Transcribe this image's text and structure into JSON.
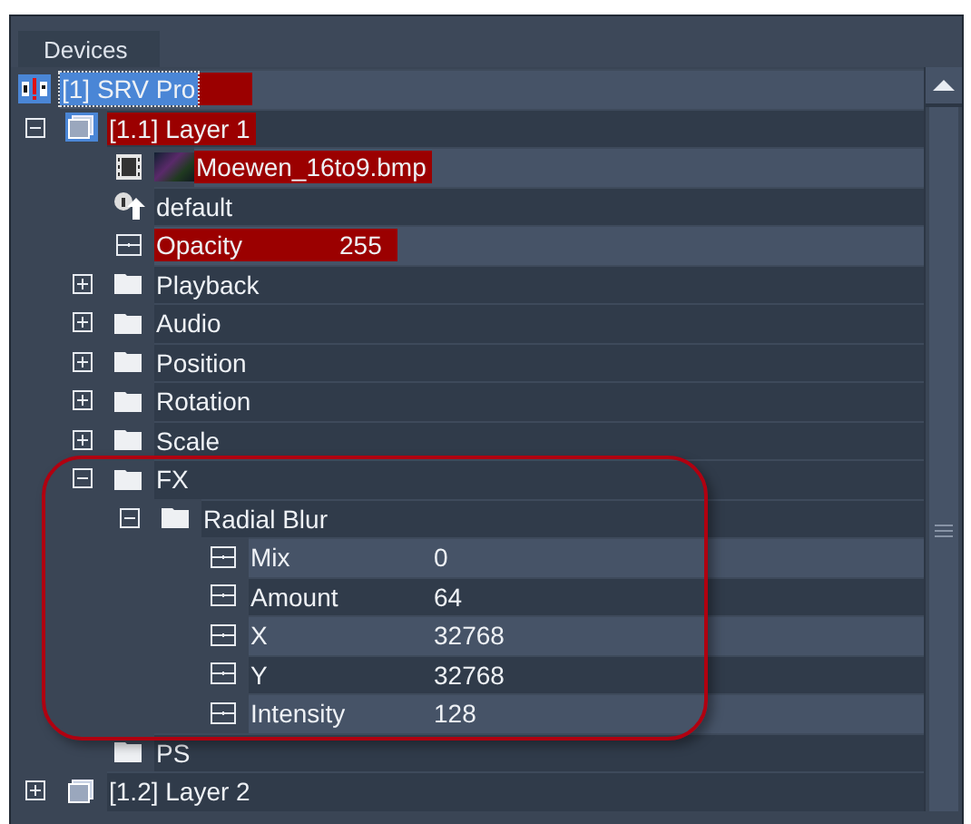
{
  "panel": {
    "title": "Devices"
  },
  "tree": [
    {
      "kind": "device",
      "label": "[1] SRV Pro",
      "selected": true,
      "highlighted": true,
      "children": [
        {
          "kind": "layer",
          "label": "[1.1] Layer 1",
          "selected": false,
          "highlighted": true,
          "expanded": true,
          "children": [
            {
              "kind": "media",
              "label": "Moewen_16to9.bmp",
              "selected": false,
              "highlighted": true
            },
            {
              "kind": "setting",
              "label": "default",
              "selected": false,
              "highlighted": false
            },
            {
              "kind": "param",
              "label": "Opacity",
              "value": "255",
              "selected": false,
              "highlighted": true
            },
            {
              "kind": "folder",
              "label": "Playback",
              "selected": false,
              "highlighted": false,
              "expanded": false
            },
            {
              "kind": "folder",
              "label": "Audio",
              "selected": false,
              "highlighted": false,
              "expanded": false
            },
            {
              "kind": "folder",
              "label": "Position",
              "selected": false,
              "highlighted": false,
              "expanded": false
            },
            {
              "kind": "folder",
              "label": "Rotation",
              "selected": false,
              "highlighted": false,
              "expanded": false
            },
            {
              "kind": "folder",
              "label": "Scale",
              "selected": false,
              "highlighted": false,
              "expanded": false
            },
            {
              "kind": "folder",
              "label": "FX",
              "selected": false,
              "highlighted": false,
              "expanded": true,
              "children": [
                {
                  "kind": "folder",
                  "label": "Radial Blur",
                  "selected": false,
                  "highlighted": false,
                  "expanded": true,
                  "children": [
                    {
                      "kind": "param",
                      "label": "Mix",
                      "value": "0",
                      "selected": false,
                      "highlighted": false
                    },
                    {
                      "kind": "param",
                      "label": "Amount",
                      "value": "64",
                      "selected": false,
                      "highlighted": false
                    },
                    {
                      "kind": "param",
                      "label": "X",
                      "value": "32768",
                      "selected": false,
                      "highlighted": false
                    },
                    {
                      "kind": "param",
                      "label": "Y",
                      "value": "32768",
                      "selected": false,
                      "highlighted": false
                    },
                    {
                      "kind": "param",
                      "label": "Intensity",
                      "value": "128",
                      "selected": false,
                      "highlighted": false
                    }
                  ]
                }
              ]
            },
            {
              "kind": "folder",
              "label": "PS",
              "selected": false,
              "highlighted": false
            }
          ]
        },
        {
          "kind": "layer",
          "label": "[1.2] Layer 2",
          "selected": false,
          "highlighted": false,
          "expanded": false
        }
      ]
    }
  ]
}
